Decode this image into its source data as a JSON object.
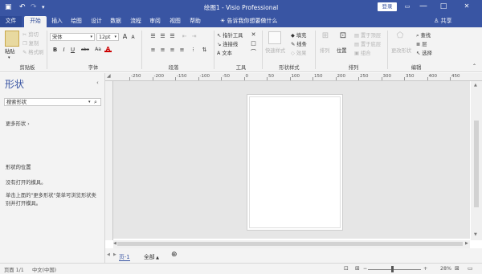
{
  "title_bar": {
    "title": "绘图1 - Visio Professional",
    "login": "登录",
    "help": "?",
    "minimize": "—",
    "restore": "□",
    "close": "✕"
  },
  "tabs": [
    "文件",
    "开始",
    "插入",
    "绘图",
    "设计",
    "数据",
    "流程",
    "审阅",
    "视图",
    "帮助"
  ],
  "tell_me": "告诉我你想要做什么",
  "share": "共享",
  "ribbon": {
    "clipboard": {
      "paste": "粘贴",
      "cut": "剪切",
      "copy": "复制",
      "format_painter": "格式刷",
      "label": "剪贴板"
    },
    "font": {
      "name": "宋体",
      "size": "12pt",
      "grow": "A",
      "shrink": "A",
      "bold": "B",
      "italic": "I",
      "underline": "U",
      "strike": "abc",
      "case": "Aa",
      "color": "A",
      "label": "字体"
    },
    "paragraph": {
      "label": "段落"
    },
    "tools": {
      "pointer": "指针工具",
      "connector": "连接线",
      "text": "文本",
      "label": "工具"
    },
    "shape_styles": {
      "quick_styles": "快速样式",
      "fill": "填充",
      "line": "线条",
      "effects": "效果",
      "label": "形状样式"
    },
    "arrange": {
      "align": "排列",
      "position": "位置",
      "bring_front": "置于顶层",
      "send_back": "置于底层",
      "group": "组合",
      "label": "排列"
    },
    "editing": {
      "change_shape": "更改形状",
      "find": "查找",
      "layers": "层",
      "select": "选择",
      "label": "编辑"
    }
  },
  "shapes_pane": {
    "heading": "形状",
    "search_placeholder": "搜索形状",
    "more_shapes": "更多形状",
    "location_heading": "形状的位置",
    "no_stencils": "没有打开的模具。",
    "hint_line1": "单击上面的\"更多形状\"菜单可浏览形状类",
    "hint_line2": "别并打开模具。"
  },
  "ruler_labels": [
    "-250",
    "-200",
    "-150",
    "-100",
    "-50",
    "0",
    "50",
    "100",
    "150",
    "200",
    "250",
    "300",
    "350",
    "400",
    "450"
  ],
  "page_tabs": {
    "page": "页-1",
    "all": "全部",
    "add": "⊕"
  },
  "status": {
    "page": "页面 1/1",
    "language": "中文(中国)",
    "zoom": "28%"
  },
  "colors": {
    "brand": "#3955a3",
    "ribbon_bg": "#f3f3f3",
    "canvas_bg": "#e6e6e6"
  }
}
